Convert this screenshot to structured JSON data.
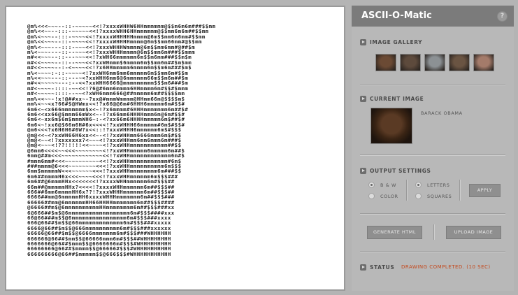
{
  "app": {
    "title": "ASCII-O-Matic",
    "help_label": "?"
  },
  "gallery": {
    "heading": "IMAGE GALLERY",
    "thumbnails": [
      {
        "name": "barack-obama",
        "color": "#6b4a34"
      },
      {
        "name": "colin-powell",
        "color": "#5d4a3c"
      },
      {
        "name": "cat",
        "color": "#8c9194"
      },
      {
        "name": "young-man",
        "color": "#6a5442"
      },
      {
        "name": "older-man",
        "color": "#a47b6a"
      }
    ]
  },
  "current": {
    "heading": "CURRENT IMAGE",
    "name": "BARACK OBAMA"
  },
  "settings": {
    "heading": "OUTPUT SETTINGS",
    "bw_label": "B & W",
    "color_label": "COLOR",
    "letters_label": "LETTERS",
    "squares_label": "SQUARES",
    "selected_color_mode": "B & W",
    "selected_char_mode": "LETTERS",
    "apply_label": "APPLY"
  },
  "actions": {
    "generate_label": "GENERATE HTML",
    "upload_label": "UPLOAD IMAGE"
  },
  "status": {
    "heading": "STATUS",
    "message": "DRAWING COMPLETED. (10 SEC)",
    "message_color": "#c4471b"
  },
  "ascii_art": [
    "@m%<<<~~~--::-~~~~~<<!?xxxxWHHW6HHmmmmmm@$$m6m6m###$$mm",
    "@m%<<~~--:::-~~~~~<<!?xxxxWHH6HHmmmmmm@$$mm6m6m##$$mm",
    "@m%<~~~--:::-~~~~<<!?xxxxWHHHHHmmmm@6m$$mm6m6mm#$$mm",
    "@m%<<~~~--::-~~~~<<!?xxxxWHHHHmmmm@6m$$mm66mm#@$$mm",
    "@m%<~~~---:::-~~~<<!?xxxWHHHWmmmm@6m$$mm6mm#@##$m",
    "m%<~~~----::--~~~<<!?xxxWHHHmmmm@6m$$mm6m###$$mmm",
    "m#<<~~~--::---~~~<<!?xWH66mmmmmm6m$$m6mm###$$m$m",
    "m#<<~~~~--::--~~~<<?xxWHmmm$6mmmm6m$$mm6m##$m$mm",
    "m#<<~~~~--:-<~~~~<<!?x6HHmmmmm6mmmm6m$$m6m###$m$",
    "m%<~~~~:-::-~~~~<!?xxWH6mm6mm6mmmmm6m$$mm6m#$$m",
    "m%<<~~~---::---~<?xxWHH6mm6@6mmmmmm66m$$m6m##$m",
    "m#<<~~~~~---:--<<?xxWHH6666@mmmmmmmmm$$$m6###$m",
    "m#<~~~~-::::-~~<<!?6@#6mm6mmmm6HHmmmm6m#$$#$mmm",
    "m#<~~~~~::::--~~<?xWH6mmm666@##mmmmm6m##$$$$mm",
    "mm%<<~~-!x!@##xx~-?xx@#mmmWmmmm@HHmm66m@$$$$m$",
    "mm%<~~<x?66#$@HWmx<<!?x66@@6m#6HHH6mmmmm6m#$$#",
    "6m6<~<x666mmmmmmm$x<~!?x6mmmm#6HHHmmmmmmm6m##$#",
    "6m6<<xx66@$mmm66mWx<~-!?x66mm6HHHHmmm6m@6m#$$#",
    "6m6<~xx6m$6m$mmmWH6~:-<?xx66m6HHHHmmmmm6m$##$#",
    "6m6<~!xx6@$66m6H#6x<<<<!?xxWHHH66mmmmm#6m$#$$#",
    "@m6<<<?x6H6H6#6W?x<<::!?xxxWHHH6mmmmmm6m$#$$$",
    "@m@<<~<?xxWH66H6xx<<~-<!?xxWHHmm6666mmm6m$#$$",
    "@m@<~~<!?xxxxxxx?<~~~<!?xxxWHHmm6mm6mmm6m###$",
    "@m@<~~~<!??!!!!!<<~~~~<!?xxWHHmmmmmmmmmmm##$$",
    "@6mm6<<<<~~<<<~~~~~~~~<!?xxWHHmmmmm6mmmmm6m##$",
    "6mm@##m<<<~~~~~~~~~~~~<<!?xWHHmmmmmmmmmmmm6m#$",
    "#mmm6mm#<<<~~~~~~~~~~<<!?xxWHHmmmmmmmmmmm#6m$",
    "###mmmm@6<<<~~~~~~~~<<<!?xxWHHmmmmmmmmmm6m$$$",
    "6mm$mmmmmW<<<~~~~~~<<<!?xxxWHHmmmmmmmm6m###$$",
    "6m6##mmmmH6x<<<~~~~<<<!?xxxWHHmmmmmm6m$$$###",
    "6m6##@6mmmHHx<<<<<<<!?xxxxWHHmmmmmm6m#$$$##",
    "66m##@mmmmmHHx?<<<<!?xxxxWHHmmmmmm6m##$$$##",
    "666##6mm6mmmmHH6x??!?xxxWHHHmmmmmm6m##$$$##",
    "6666##mm@6mmmmmHH6xxxxWHHHmmmmmmm6m##$$$###",
    "66666##mm@6mmmmmmHH66HHHHmmmmmmm6m##$$$####",
    "@6666##m$@6mmmmmmmmmmHHmmmmmmmm6m##$$$###xx",
    "6@666##$m$@6mmmmmmmmmmmmmmmmmm6m#$$$####xxx",
    "66@66###m$$@6mmmmmmmmmmmmmmmm6m#$$$###xxxx",
    "666@66##$m$$@66mmmmmmmmmmmmm6m#$$$###xxxxx",
    "6666@66##$m$$@666mmmmmmmmmm6m#$$$###xxxxxx",
    "66666@66##$m$$@6666mmmmmmm6m#$$$###WHHHHHH",
    "666666@66##$mm$$@66666mmm6m#$$$##WHHHHHHHH",
    "6666666@66##$mmm$$@6666666m#$$$#WHHHHHHHHH",
    "66666666@66##$mmmm$$@66666#$$$#WHHHHHHHHHH",
    "666666666@66##$mmmmm$$@666$$$#WHHHHHHHHHHH"
  ]
}
